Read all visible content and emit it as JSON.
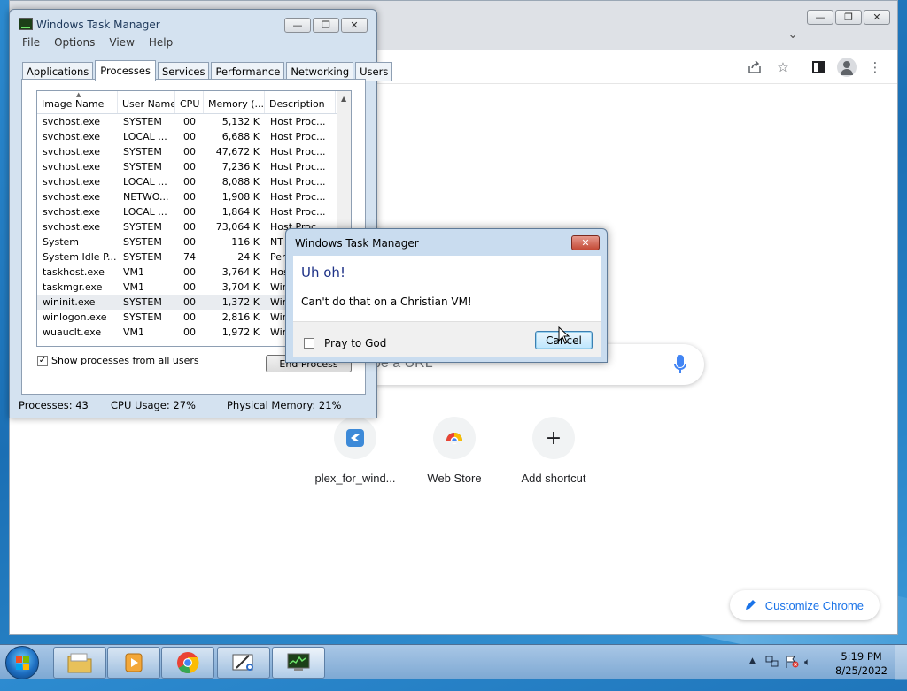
{
  "chrome": {
    "search_placeholder": "pe a URL",
    "shortcuts": [
      {
        "label": "plex_for_wind..."
      },
      {
        "label": "Web Store"
      },
      {
        "label": "Add shortcut"
      }
    ],
    "customize_label": "Customize Chrome",
    "colors": {
      "accent": "#1a73e8",
      "mic": "#4285f4"
    }
  },
  "task_manager": {
    "title": "Windows Task Manager",
    "menu": [
      "File",
      "Options",
      "View",
      "Help"
    ],
    "tabs": [
      "Applications",
      "Processes",
      "Services",
      "Performance",
      "Networking",
      "Users"
    ],
    "active_tab": "Processes",
    "columns": [
      "Image Name",
      "User Name",
      "CPU",
      "Memory (...",
      "Description"
    ],
    "rows": [
      {
        "image": "svchost.exe",
        "user": "SYSTEM",
        "cpu": "00",
        "mem": "5,132 K",
        "desc": "Host Proc..."
      },
      {
        "image": "svchost.exe",
        "user": "LOCAL ...",
        "cpu": "00",
        "mem": "6,688 K",
        "desc": "Host Proc..."
      },
      {
        "image": "svchost.exe",
        "user": "SYSTEM",
        "cpu": "00",
        "mem": "47,672 K",
        "desc": "Host Proc..."
      },
      {
        "image": "svchost.exe",
        "user": "SYSTEM",
        "cpu": "00",
        "mem": "7,236 K",
        "desc": "Host Proc..."
      },
      {
        "image": "svchost.exe",
        "user": "LOCAL ...",
        "cpu": "00",
        "mem": "8,088 K",
        "desc": "Host Proc..."
      },
      {
        "image": "svchost.exe",
        "user": "NETWO...",
        "cpu": "00",
        "mem": "1,908 K",
        "desc": "Host Proc..."
      },
      {
        "image": "svchost.exe",
        "user": "LOCAL ...",
        "cpu": "00",
        "mem": "1,864 K",
        "desc": "Host Proc..."
      },
      {
        "image": "svchost.exe",
        "user": "SYSTEM",
        "cpu": "00",
        "mem": "73,064 K",
        "desc": "Host Proc..."
      },
      {
        "image": "System",
        "user": "SYSTEM",
        "cpu": "00",
        "mem": "116 K",
        "desc": "NT"
      },
      {
        "image": "System Idle P...",
        "user": "SYSTEM",
        "cpu": "74",
        "mem": "24 K",
        "desc": "Per"
      },
      {
        "image": "taskhost.exe",
        "user": "VM1",
        "cpu": "00",
        "mem": "3,764 K",
        "desc": "Hos"
      },
      {
        "image": "taskmgr.exe",
        "user": "VM1",
        "cpu": "00",
        "mem": "3,704 K",
        "desc": "Win"
      },
      {
        "image": "wininit.exe",
        "user": "SYSTEM",
        "cpu": "00",
        "mem": "1,372 K",
        "desc": "Win"
      },
      {
        "image": "winlogon.exe",
        "user": "SYSTEM",
        "cpu": "00",
        "mem": "2,816 K",
        "desc": "Win"
      },
      {
        "image": "wuauclt.exe",
        "user": "VM1",
        "cpu": "00",
        "mem": "1,972 K",
        "desc": "Win"
      }
    ],
    "selected_row": 12,
    "show_all_label": "Show processes from all users",
    "show_all_checked": true,
    "end_process_label": "End Process",
    "status": {
      "processes": "Processes: 43",
      "cpu": "CPU Usage: 27%",
      "memory": "Physical Memory: 21%"
    }
  },
  "dialog": {
    "title": "Windows Task Manager",
    "heading": "Uh oh!",
    "message": "Can't do that on a Christian VM!",
    "checkbox_label": "Pray to God",
    "checkbox_checked": false,
    "cancel_label": "Cancel"
  },
  "taskbar": {
    "time": "5:19 PM",
    "date": "8/25/2022"
  }
}
